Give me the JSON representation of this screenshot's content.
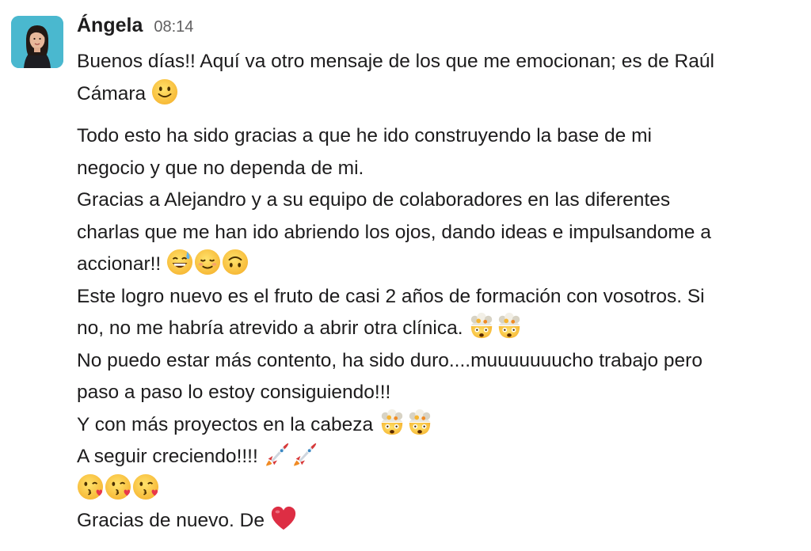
{
  "message": {
    "author": "Ángela",
    "timestamp": "08:14",
    "avatar_icon": "person-avatar-icon",
    "lines": [
      "Buenos días!! Aquí va otro mensaje de los que me emocionan; es de Raúl",
      "Cámara",
      "Todo esto ha sido gracias a que he ido construyendo la base de mi",
      "negocio y que no dependa de mi.",
      "Gracias a Alejandro y a su equipo de colaboradores en las diferentes",
      "charlas que me han ido abriendo los ojos, dando ideas e impulsandome a",
      "accionar!!",
      "Este logro nuevo es el fruto de casi 2 años de formación con vosotros. Si",
      "no, no me habría atrevido a abrir otra clínica.",
      "No puedo estar más contento, ha sido duro....muuuuuuucho trabajo pero",
      "paso a paso lo estoy consiguiendo!!!",
      "Y con más proyectos en la cabeza",
      "A seguir creciendo!!!!",
      "Gracias de nuevo. De"
    ],
    "emojis": {
      "line1": [
        "slightly-smiling-face-emoji"
      ],
      "line6": [
        "sweat-smile-emoji",
        "relaxed-smile-emoji",
        "upside-down-face-emoji"
      ],
      "line8": [
        "exploding-head-emoji",
        "exploding-head-emoji"
      ],
      "line11": [
        "exploding-head-emoji",
        "exploding-head-emoji"
      ],
      "line12": [
        "rocket-emoji",
        "rocket-emoji"
      ],
      "kiss_line": [
        "face-blowing-kiss-emoji",
        "face-blowing-kiss-emoji",
        "face-blowing-kiss-emoji"
      ],
      "line13": [
        "red-heart-emoji"
      ]
    }
  }
}
